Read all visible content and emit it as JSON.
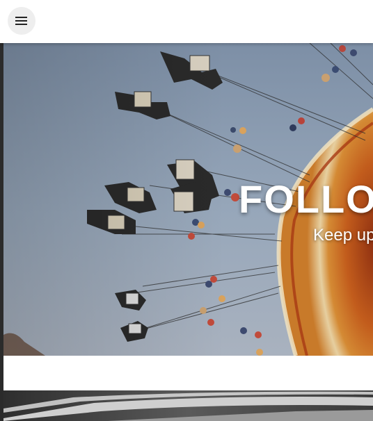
{
  "header": {
    "menu_icon": "menu-icon"
  },
  "hero": {
    "title": "FOLLOW",
    "subtitle": "Keep up",
    "image": "swing-carousel-photo",
    "sky_color": "#8aa0b8",
    "accent_color": "#c8661e"
  },
  "second_section": {
    "image": "rail-track-photo"
  }
}
